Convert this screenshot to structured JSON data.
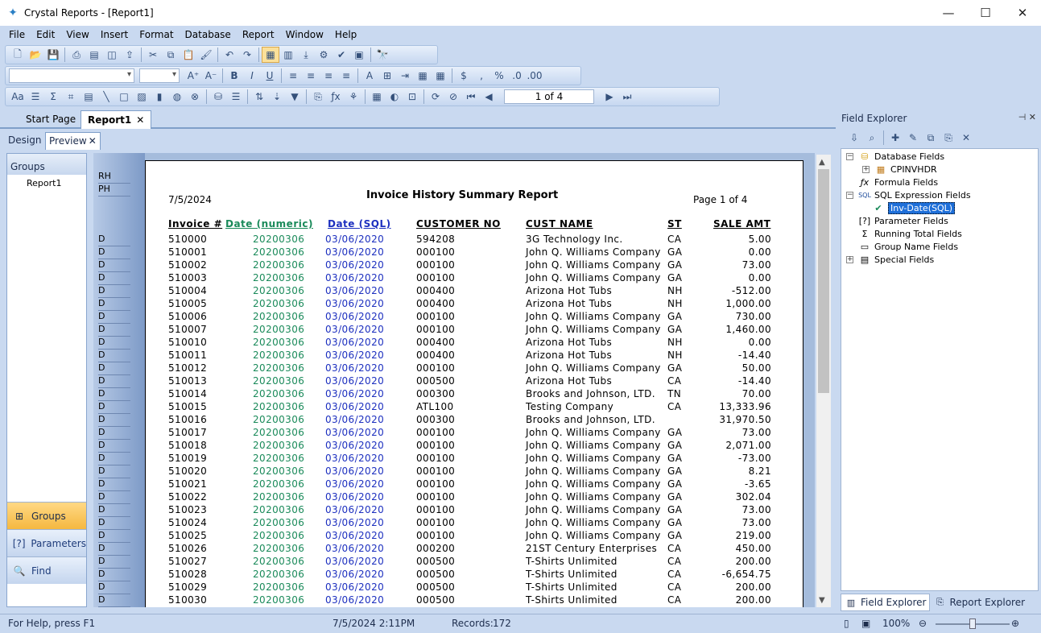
{
  "window": {
    "title": "Crystal Reports - [Report1]"
  },
  "menu": [
    "File",
    "Edit",
    "View",
    "Insert",
    "Format",
    "Database",
    "Report",
    "Window",
    "Help"
  ],
  "navigation": {
    "page_indicator": "1 of 4"
  },
  "tabs": {
    "doc": [
      "Start Page",
      "Report1"
    ],
    "view": [
      "Design",
      "Preview"
    ]
  },
  "groups_panel": {
    "title": "Groups",
    "items": [
      "Report1"
    ],
    "buttons": [
      "Groups",
      "Parameters",
      "Find"
    ]
  },
  "sections": {
    "rh": "RH",
    "ph": "PH",
    "detail": "D"
  },
  "report": {
    "date": "7/5/2024",
    "title": "Invoice History Summary Report",
    "page_number": "Page 1 of 4",
    "columns": [
      "Invoice #",
      "Date (numeric)",
      "Date (SQL)",
      "CUSTOMER NO",
      "CUST NAME",
      "ST",
      "SALE AMT"
    ],
    "rows": [
      [
        "510000",
        "20200306",
        "03/06/2020",
        "594208",
        "3G Technology Inc.",
        "CA",
        "5.00"
      ],
      [
        "510001",
        "20200306",
        "03/06/2020",
        "000100",
        "John Q. Williams Company",
        "GA",
        "0.00"
      ],
      [
        "510002",
        "20200306",
        "03/06/2020",
        "000100",
        "John Q. Williams Company",
        "GA",
        "73.00"
      ],
      [
        "510003",
        "20200306",
        "03/06/2020",
        "000100",
        "John Q. Williams Company",
        "GA",
        "0.00"
      ],
      [
        "510004",
        "20200306",
        "03/06/2020",
        "000400",
        "Arizona Hot Tubs",
        "NH",
        "-512.00"
      ],
      [
        "510005",
        "20200306",
        "03/06/2020",
        "000400",
        "Arizona Hot Tubs",
        "NH",
        "1,000.00"
      ],
      [
        "510006",
        "20200306",
        "03/06/2020",
        "000100",
        "John Q. Williams Company",
        "GA",
        "730.00"
      ],
      [
        "510007",
        "20200306",
        "03/06/2020",
        "000100",
        "John Q. Williams Company",
        "GA",
        "1,460.00"
      ],
      [
        "510010",
        "20200306",
        "03/06/2020",
        "000400",
        "Arizona Hot Tubs",
        "NH",
        "0.00"
      ],
      [
        "510011",
        "20200306",
        "03/06/2020",
        "000400",
        "Arizona Hot Tubs",
        "NH",
        "-14.40"
      ],
      [
        "510012",
        "20200306",
        "03/06/2020",
        "000100",
        "John Q. Williams Company",
        "GA",
        "50.00"
      ],
      [
        "510013",
        "20200306",
        "03/06/2020",
        "000500",
        "Arizona Hot Tubs",
        "CA",
        "-14.40"
      ],
      [
        "510014",
        "20200306",
        "03/06/2020",
        "000300",
        "Brooks and Johnson, LTD.",
        "TN",
        "70.00"
      ],
      [
        "510015",
        "20200306",
        "03/06/2020",
        "ATL100",
        "Testing Company",
        "CA",
        "13,333.96"
      ],
      [
        "510016",
        "20200306",
        "03/06/2020",
        "000300",
        "Brooks and Johnson, LTD.",
        "",
        "31,970.50"
      ],
      [
        "510017",
        "20200306",
        "03/06/2020",
        "000100",
        "John Q. Williams Company",
        "GA",
        "73.00"
      ],
      [
        "510018",
        "20200306",
        "03/06/2020",
        "000100",
        "John Q. Williams Company",
        "GA",
        "2,071.00"
      ],
      [
        "510019",
        "20200306",
        "03/06/2020",
        "000100",
        "John Q. Williams Company",
        "GA",
        "-73.00"
      ],
      [
        "510020",
        "20200306",
        "03/06/2020",
        "000100",
        "John Q. Williams Company",
        "GA",
        "8.21"
      ],
      [
        "510021",
        "20200306",
        "03/06/2020",
        "000100",
        "John Q. Williams Company",
        "GA",
        "-3.65"
      ],
      [
        "510022",
        "20200306",
        "03/06/2020",
        "000100",
        "John Q. Williams Company",
        "GA",
        "302.04"
      ],
      [
        "510023",
        "20200306",
        "03/06/2020",
        "000100",
        "John Q. Williams Company",
        "GA",
        "73.00"
      ],
      [
        "510024",
        "20200306",
        "03/06/2020",
        "000100",
        "John Q. Williams Company",
        "GA",
        "73.00"
      ],
      [
        "510025",
        "20200306",
        "03/06/2020",
        "000100",
        "John Q. Williams Company",
        "GA",
        "219.00"
      ],
      [
        "510026",
        "20200306",
        "03/06/2020",
        "000200",
        "21ST Century Enterprises",
        "CA",
        "450.00"
      ],
      [
        "510027",
        "20200306",
        "03/06/2020",
        "000500",
        "T-Shirts Unlimited",
        "CA",
        "200.00"
      ],
      [
        "510028",
        "20200306",
        "03/06/2020",
        "000500",
        "T-Shirts Unlimited",
        "CA",
        "-6,654.75"
      ],
      [
        "510029",
        "20200306",
        "03/06/2020",
        "000500",
        "T-Shirts Unlimited",
        "CA",
        "200.00"
      ],
      [
        "510030",
        "20200306",
        "03/06/2020",
        "000500",
        "T-Shirts Unlimited",
        "CA",
        "200.00"
      ]
    ]
  },
  "field_explorer": {
    "title": "Field Explorer",
    "nodes": [
      "Database Fields",
      "CPINVHDR",
      "Formula Fields",
      "SQL Expression Fields",
      "Inv-Date(SQL)",
      "Parameter Fields",
      "Running Total Fields",
      "Group Name Fields",
      "Special Fields"
    ],
    "tabs": [
      "Field Explorer",
      "Report Explorer"
    ]
  },
  "status": {
    "help": "For Help, press F1",
    "datetime": "7/5/2024  2:11PM",
    "records_label": "Records:",
    "records": "172",
    "zoom": "100%"
  }
}
